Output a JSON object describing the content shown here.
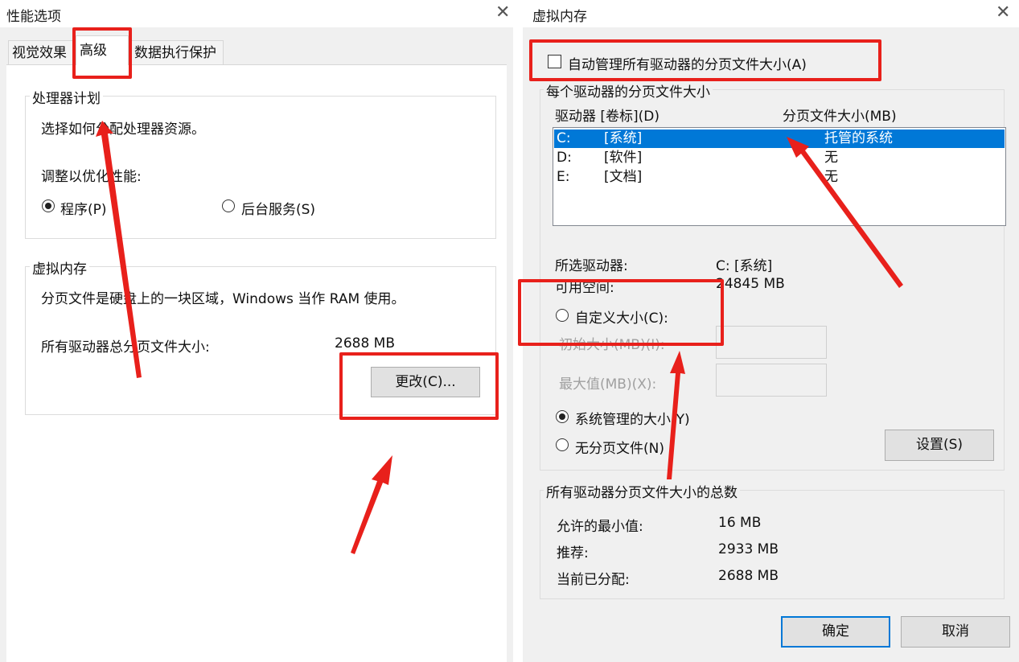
{
  "left": {
    "title": "性能选项",
    "tabs": [
      "视觉效果",
      "高级",
      "数据执行保护"
    ],
    "processor": {
      "group_title": "处理器计划",
      "desc": "选择如何分配处理器资源。",
      "optimize_label": "调整以优化性能:",
      "opt_programs": "程序(P)",
      "opt_services": "后台服务(S)",
      "selected": "程序(P)"
    },
    "vm": {
      "group_title": "虚拟内存",
      "desc": "分页文件是硬盘上的一块区域，Windows 当作 RAM 使用。",
      "total_label": "所有驱动器总分页文件大小:",
      "total_value": "2688 MB",
      "change_button": "更改(C)..."
    }
  },
  "right": {
    "title": "虚拟内存",
    "auto_manage": "自动管理所有驱动器的分页文件大小(A)",
    "auto_manage_checked": false,
    "per_drive_group": "每个驱动器的分页文件大小",
    "col_drive": "驱动器 [卷标](D)",
    "col_size": "分页文件大小(MB)",
    "drives": [
      {
        "letter": "C:",
        "label": "[系统]",
        "size": "托管的系统",
        "selected": true
      },
      {
        "letter": "D:",
        "label": "[软件]",
        "size": "无",
        "selected": false
      },
      {
        "letter": "E:",
        "label": "[文档]",
        "size": "无",
        "selected": false
      }
    ],
    "selected_drive_label": "所选驱动器:",
    "selected_drive_value": "C:  [系统]",
    "free_space_label": "可用空间:",
    "free_space_value": "24845 MB",
    "custom_size": "自定义大小(C):",
    "initial_size": "初始大小(MB)(I):",
    "max_size": "最大值(MB)(X):",
    "system_managed": "系统管理的大小(Y)",
    "no_paging": "无分页文件(N)",
    "set_button": "设置(S)",
    "totals_group": "所有驱动器分页文件大小的总数",
    "min_label": "允许的最小值:",
    "min_value": "16 MB",
    "recommended_label": "推荐:",
    "recommended_value": "2933 MB",
    "current_label": "当前已分配:",
    "current_value": "2688 MB",
    "ok_button": "确定",
    "cancel_button": "取消"
  },
  "colors": {
    "annotation_red": "#e8201b",
    "selection_blue": "#0078d7",
    "dialog_bg": "#f0f0f0"
  }
}
